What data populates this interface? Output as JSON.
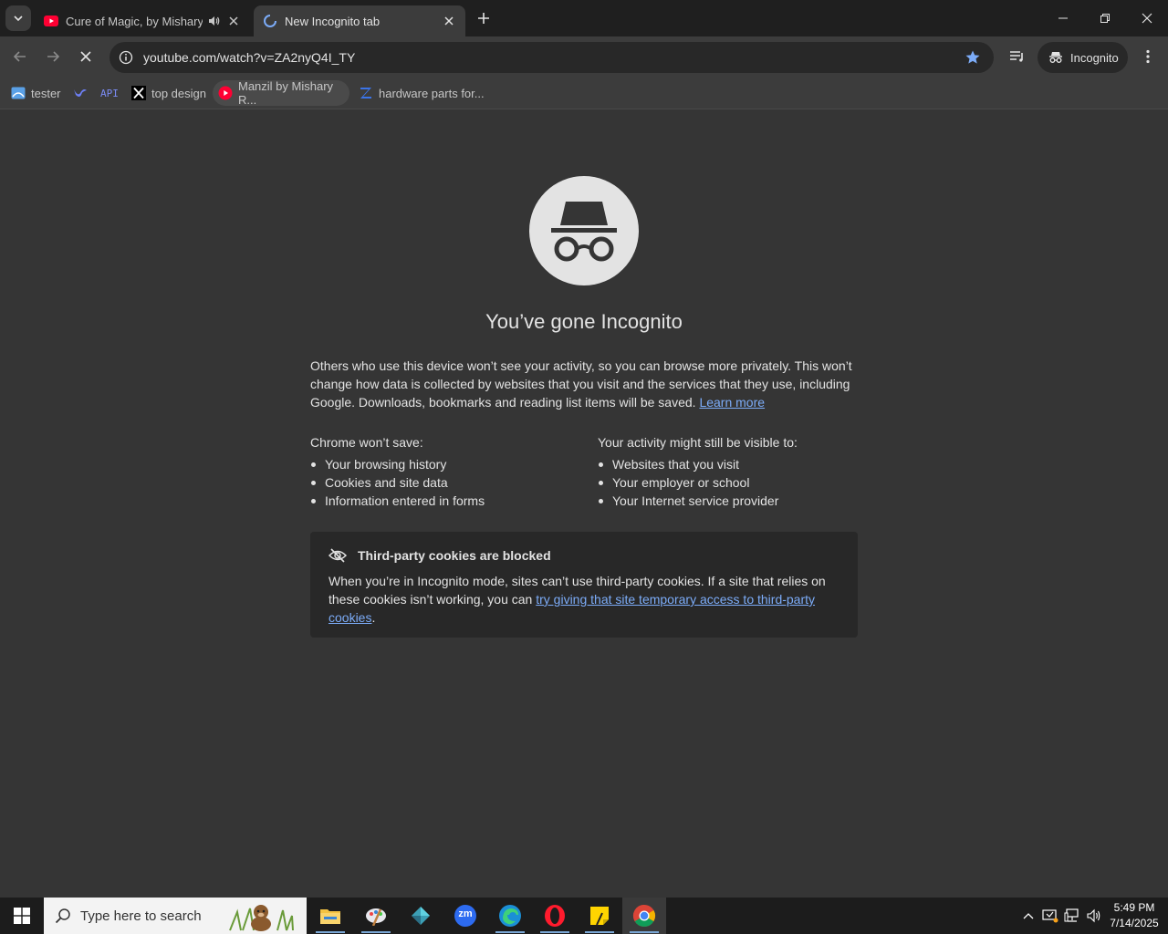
{
  "tabs": [
    {
      "title": "Cure of Magic, by Mishary R",
      "audio": true,
      "active": false
    },
    {
      "title": "New Incognito tab",
      "loading": true,
      "active": true
    }
  ],
  "toolbar": {
    "url": "youtube.com/watch?v=ZA2nyQ4I_TY",
    "incognito_label": "Incognito",
    "star_color": "#7cacf8"
  },
  "bookmarks": [
    {
      "label": "tester"
    },
    {
      "label": ""
    },
    {
      "label": "API"
    },
    {
      "label": "top design"
    },
    {
      "label": "Manzil by Mishary R..."
    },
    {
      "label": "hardware parts for..."
    }
  ],
  "page": {
    "heading": "You’ve gone Incognito",
    "intro": "Others who use this device won’t see your activity, so you can browse more privately. This won’t change how data is collected by websites that you visit and the services that they use, including Google. Downloads, bookmarks and reading list items will be saved.",
    "learn_more": "Learn more",
    "wont_save": {
      "heading": "Chrome won’t save:",
      "items": [
        "Your browsing history",
        "Cookies and site data",
        "Information entered in forms"
      ]
    },
    "visible_to": {
      "heading": "Your activity might still be visible to:",
      "items": [
        "Websites that you visit",
        "Your employer or school",
        "Your Internet service provider"
      ]
    },
    "cookies": {
      "heading": "Third-party cookies are blocked",
      "text": "When you’re in Incognito mode, sites can’t use third-party cookies. If a site that relies on these cookies isn’t working, you can ",
      "link": "try giving that site temporary access to third-party cookies",
      "end": "."
    }
  },
  "taskbar": {
    "search_placeholder": "Type here to search",
    "time": "5:49 PM",
    "date": "7/14/2025",
    "apps": [
      "file-explorer",
      "paint",
      "app",
      "zoom",
      "edge",
      "opera",
      "sticky-notes",
      "chrome"
    ],
    "zoom_label": "zm"
  }
}
